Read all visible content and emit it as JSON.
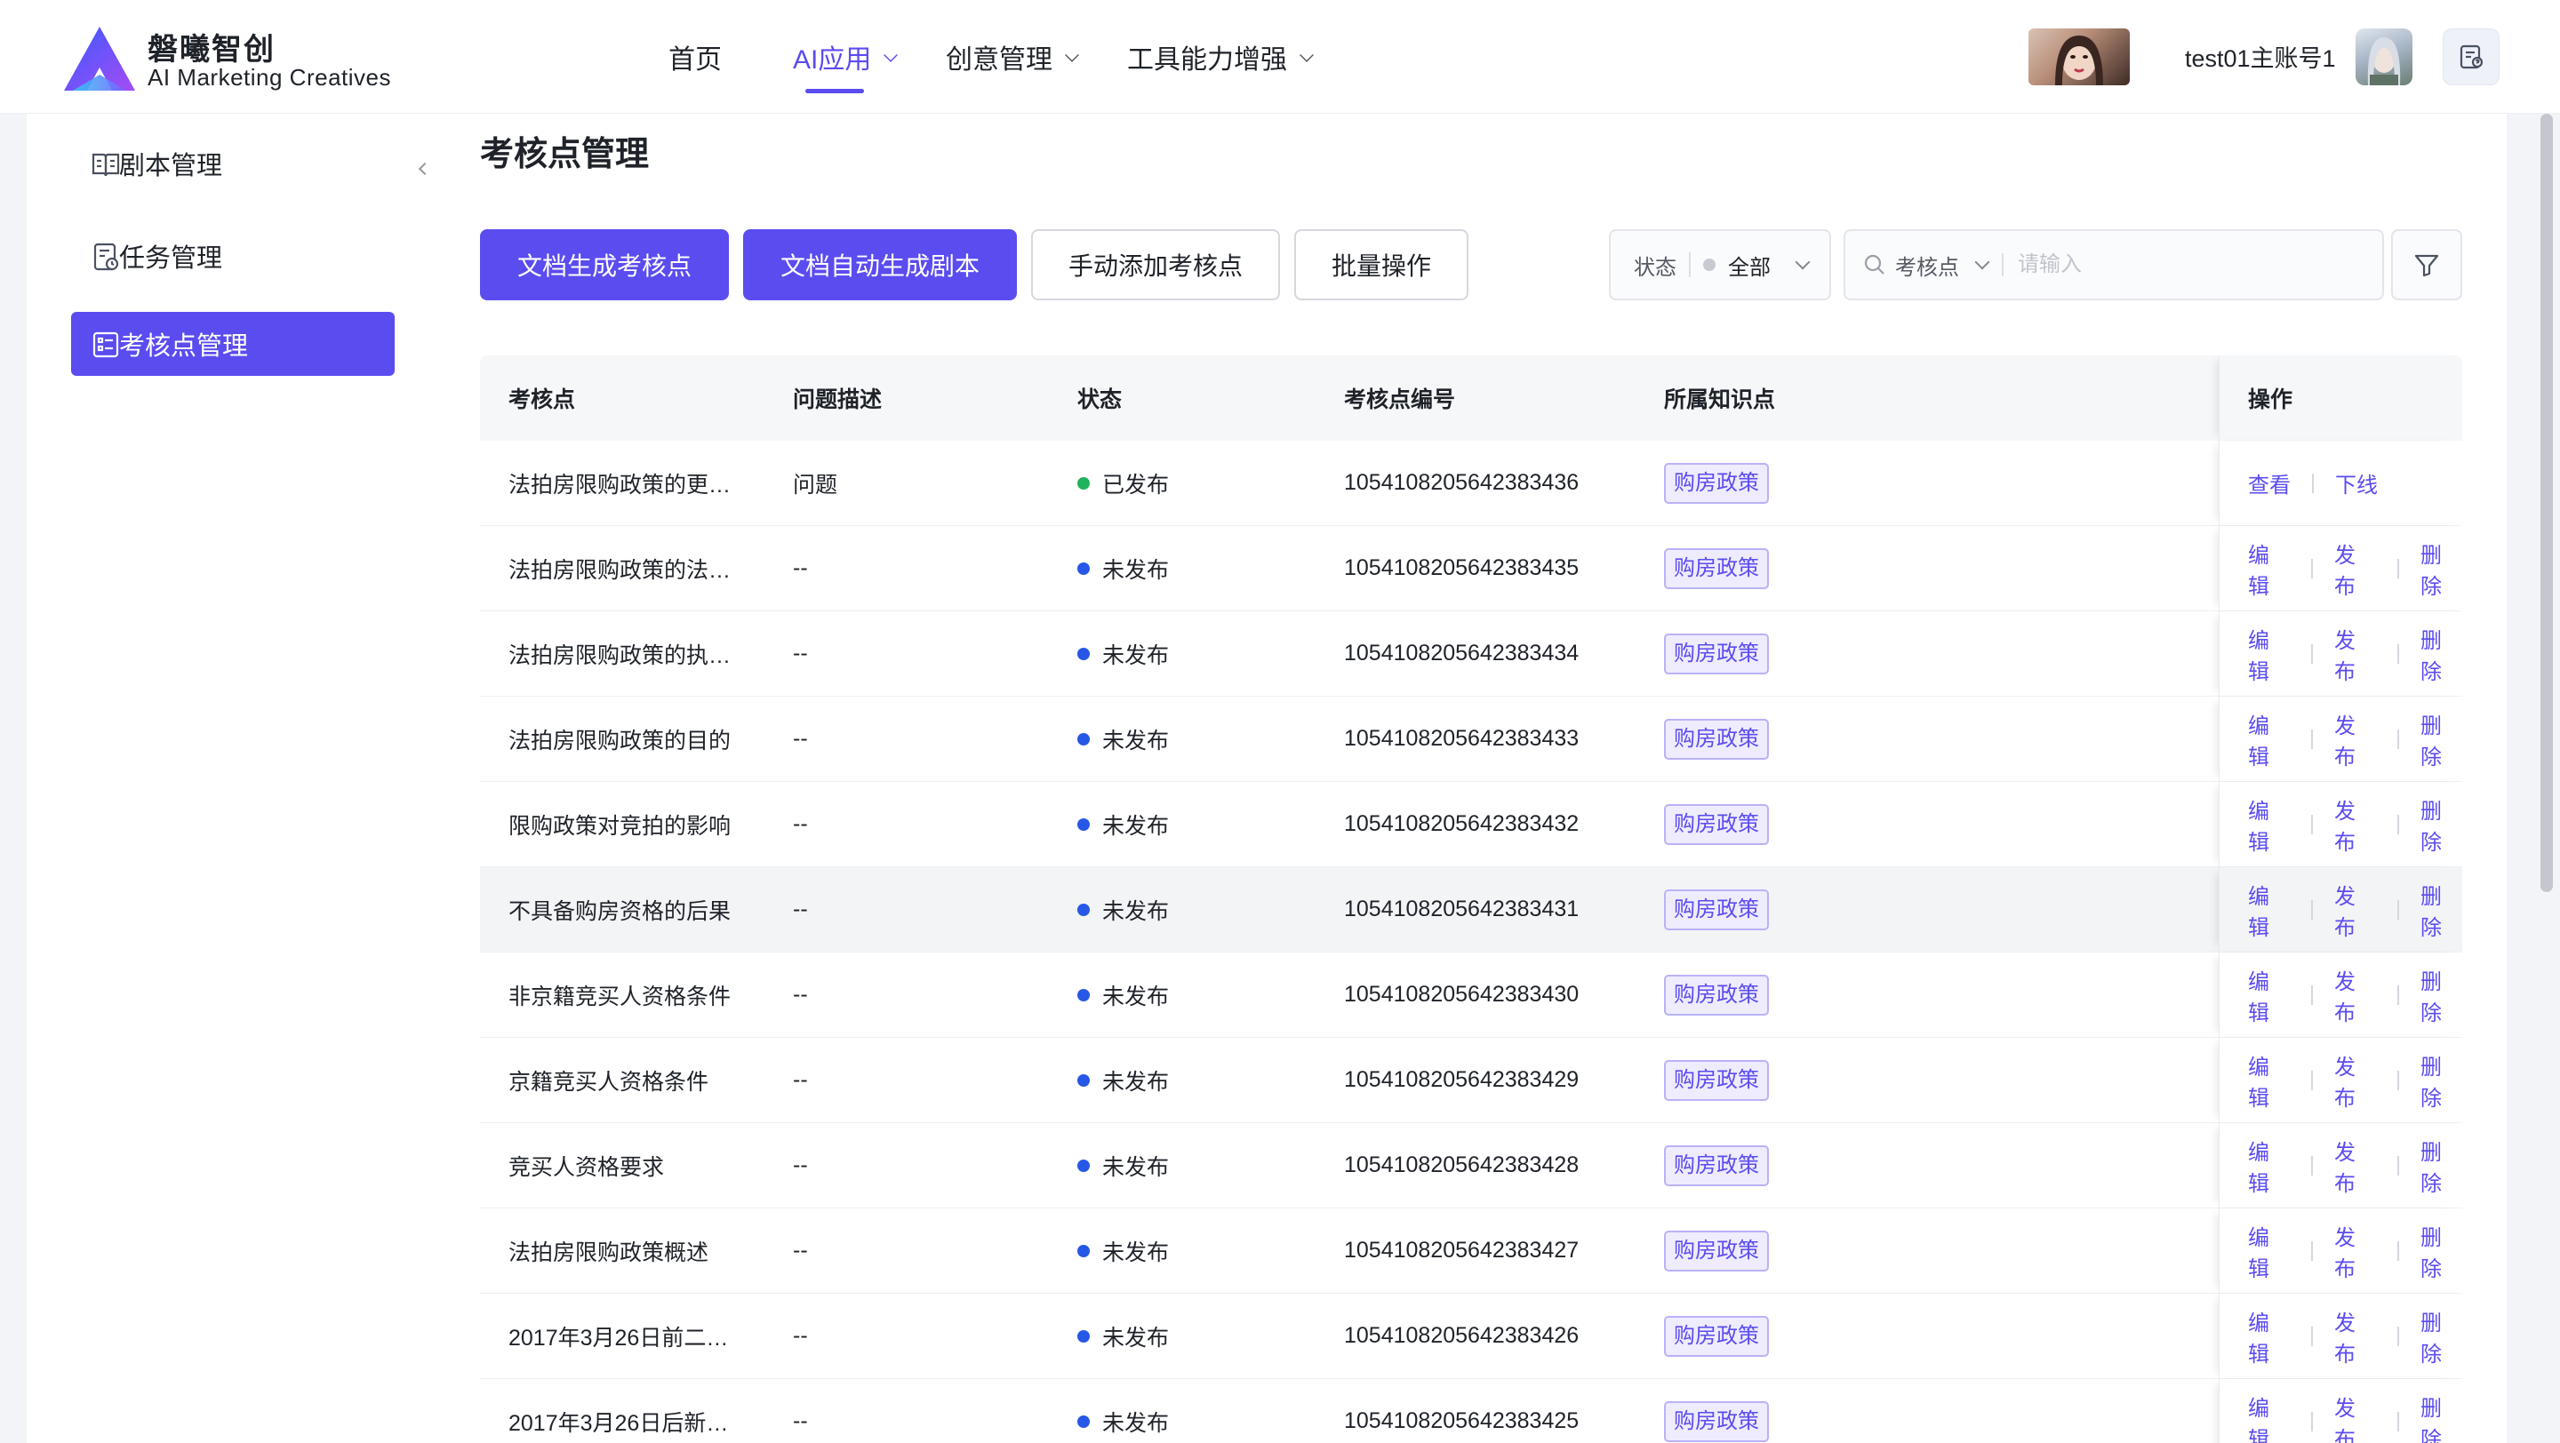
{
  "brand": {
    "name_cn": "磐曦智创",
    "name_en": "AI Marketing Creatives"
  },
  "nav": {
    "items": [
      {
        "label": "首页",
        "active": false,
        "dropdown": false
      },
      {
        "label": "AI应用",
        "active": true,
        "dropdown": true
      },
      {
        "label": "创意管理",
        "active": false,
        "dropdown": true
      },
      {
        "label": "工具能力增强",
        "active": false,
        "dropdown": true
      }
    ]
  },
  "account": {
    "name": "test01主账号1"
  },
  "sidebar": {
    "items": [
      {
        "label": "剧本管理",
        "icon": "book-icon",
        "active": false
      },
      {
        "label": "任务管理",
        "icon": "task-icon",
        "active": false
      },
      {
        "label": "考核点管理",
        "icon": "list-icon",
        "active": true
      }
    ]
  },
  "page": {
    "title": "考核点管理"
  },
  "toolbar": {
    "btn_generate_points": "文档生成考核点",
    "btn_generate_script": "文档自动生成剧本",
    "btn_add_manual": "手动添加考核点",
    "btn_batch": "批量操作"
  },
  "filters": {
    "status_label": "状态",
    "status_value": "全部",
    "search_field": "考核点",
    "search_placeholder": "请输入"
  },
  "table": {
    "columns": [
      "考核点",
      "问题描述",
      "状态",
      "考核点编号",
      "所属知识点",
      "操作"
    ],
    "rows": [
      {
        "point": "法拍房限购政策的更…",
        "desc": "问题",
        "status": "已发布",
        "status_color": "#1fb45b",
        "id": "1054108205642383436",
        "tag": "购房政策",
        "ops": [
          "查看",
          "下线"
        ]
      },
      {
        "point": "法拍房限购政策的法…",
        "desc": "--",
        "status": "未发布",
        "status_color": "#2657e6",
        "id": "1054108205642383435",
        "tag": "购房政策",
        "ops": [
          "编辑",
          "发布",
          "删除"
        ]
      },
      {
        "point": "法拍房限购政策的执…",
        "desc": "--",
        "status": "未发布",
        "status_color": "#2657e6",
        "id": "1054108205642383434",
        "tag": "购房政策",
        "ops": [
          "编辑",
          "发布",
          "删除"
        ]
      },
      {
        "point": "法拍房限购政策的目的",
        "desc": "--",
        "status": "未发布",
        "status_color": "#2657e6",
        "id": "1054108205642383433",
        "tag": "购房政策",
        "ops": [
          "编辑",
          "发布",
          "删除"
        ]
      },
      {
        "point": "限购政策对竞拍的影响",
        "desc": "--",
        "status": "未发布",
        "status_color": "#2657e6",
        "id": "1054108205642383432",
        "tag": "购房政策",
        "ops": [
          "编辑",
          "发布",
          "删除"
        ]
      },
      {
        "point": "不具备购房资格的后果",
        "desc": "--",
        "status": "未发布",
        "status_color": "#2657e6",
        "id": "1054108205642383431",
        "tag": "购房政策",
        "ops": [
          "编辑",
          "发布",
          "删除"
        ],
        "hover": true
      },
      {
        "point": "非京籍竞买人资格条件",
        "desc": "--",
        "status": "未发布",
        "status_color": "#2657e6",
        "id": "1054108205642383430",
        "tag": "购房政策",
        "ops": [
          "编辑",
          "发布",
          "删除"
        ]
      },
      {
        "point": "京籍竞买人资格条件",
        "desc": "--",
        "status": "未发布",
        "status_color": "#2657e6",
        "id": "1054108205642383429",
        "tag": "购房政策",
        "ops": [
          "编辑",
          "发布",
          "删除"
        ]
      },
      {
        "point": "竞买人资格要求",
        "desc": "--",
        "status": "未发布",
        "status_color": "#2657e6",
        "id": "1054108205642383428",
        "tag": "购房政策",
        "ops": [
          "编辑",
          "发布",
          "删除"
        ]
      },
      {
        "point": "法拍房限购政策概述",
        "desc": "--",
        "status": "未发布",
        "status_color": "#2657e6",
        "id": "1054108205642383427",
        "tag": "购房政策",
        "ops": [
          "编辑",
          "发布",
          "删除"
        ]
      },
      {
        "point": "2017年3月26日前二…",
        "desc": "--",
        "status": "未发布",
        "status_color": "#2657e6",
        "id": "1054108205642383426",
        "tag": "购房政策",
        "ops": [
          "编辑",
          "发布",
          "删除"
        ]
      },
      {
        "point": "2017年3月26日后新…",
        "desc": "--",
        "status": "未发布",
        "status_color": "#2657e6",
        "id": "1054108205642383425",
        "tag": "购房政策",
        "ops": [
          "编辑",
          "发布",
          "删除"
        ]
      }
    ]
  },
  "colors": {
    "accent": "#5b4cf0",
    "published": "#1fb45b",
    "unpublished": "#2657e6"
  }
}
